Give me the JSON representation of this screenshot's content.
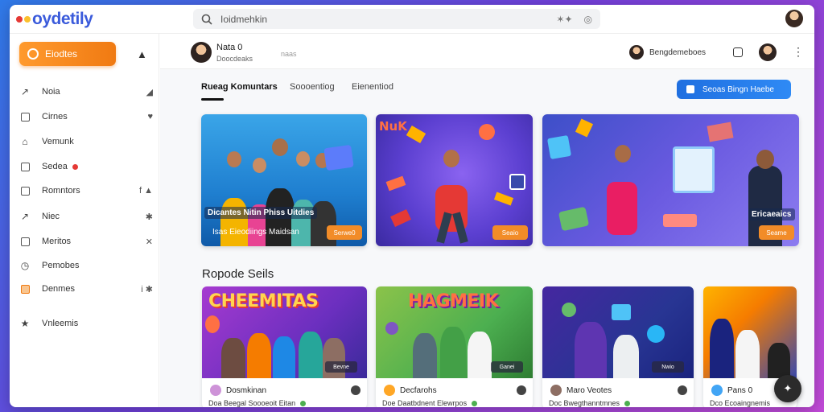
{
  "app": {
    "logo_text": "oydetily"
  },
  "search": {
    "placeholder": "Ioidmehkin"
  },
  "sidebar": {
    "primary_button": "Eiodtes",
    "items": [
      {
        "label": "Noia",
        "icon": "feather-icon",
        "trail": "edit-icon"
      },
      {
        "label": "Cirnes",
        "icon": "square-icon",
        "trail": "heart-icon"
      },
      {
        "label": "Vemunk",
        "icon": "home-icon",
        "trail": ""
      },
      {
        "label": "Sedea",
        "icon": "square-icon",
        "trail": "",
        "badge": true
      },
      {
        "label": "Romntors",
        "icon": "square-icon",
        "trail": "f ▲"
      },
      {
        "label": "Niec",
        "icon": "feather-icon",
        "trail": "✱"
      },
      {
        "label": "Meritos",
        "icon": "square-icon",
        "trail": "✕"
      },
      {
        "label": "Pemobes",
        "icon": "clock-icon",
        "trail": ""
      },
      {
        "label": "Denmes",
        "icon": "orange-square-icon",
        "trail": "i ✱"
      },
      {
        "label": "Vnleemis",
        "icon": "star-icon",
        "trail": ""
      }
    ]
  },
  "profile_bar": {
    "name": "Nata 0",
    "sub": "Doocdeaks",
    "sub2": "naas",
    "user_name": "Bengdemeboes"
  },
  "tabs": [
    "Rueag Komuntars",
    "Soooentiog",
    "Eienentiod"
  ],
  "cta_button": "Seoas Bingn Haebe",
  "feature_cards": [
    {
      "caption": "Dicantes Nitin Phiss Uitdies",
      "footer": "Isas   Eieodiings Maidsan",
      "button": "Serwe0"
    },
    {
      "caption": "",
      "footer": "",
      "button": "Seaio"
    },
    {
      "caption": "Ericaeaics",
      "footer": "",
      "button": "Seame"
    }
  ],
  "section_title": "Ropode Seils",
  "bottom_cards": [
    {
      "banner": "CHEEMITAS",
      "meta": "Dosmkinan",
      "sub": "Doa  Beegal Soooeoit Eitan",
      "tag": "Bevne"
    },
    {
      "banner": "HAGMEIK",
      "meta": "Decfarohs",
      "sub": "Doe  Daatbdnent Elewrpos",
      "tag": "Ganei"
    },
    {
      "banner": "",
      "meta": "Maro Veotes",
      "sub": "Doc  Bwegthanntmnes",
      "tag": "Nwio"
    },
    {
      "banner": "",
      "meta": "Pans 0",
      "sub": "Dco  Ecoaingnemis",
      "tag": ""
    }
  ],
  "colors": {
    "accent_orange": "#f07a12",
    "accent_blue": "#1f6fe0",
    "logo_blue": "#3b5bdb"
  }
}
